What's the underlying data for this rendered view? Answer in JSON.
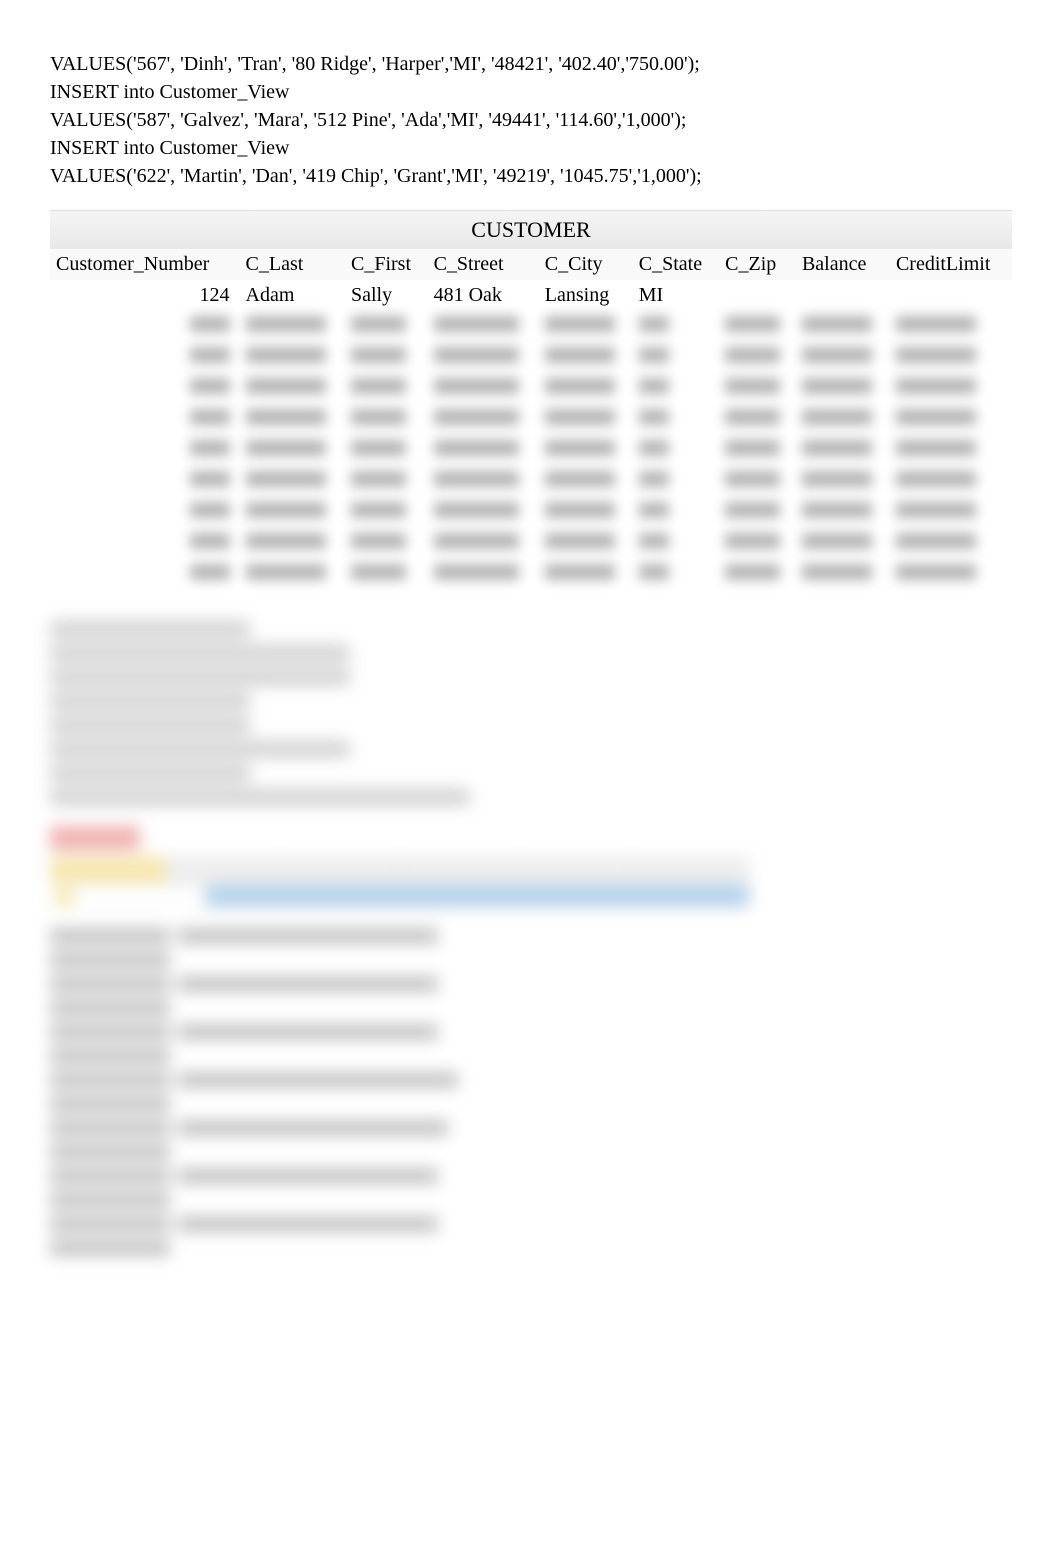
{
  "sql": {
    "lines": [
      "VALUES('567', 'Dinh', 'Tran', '80 Ridge', 'Harper','MI', '48421', '402.40','750.00');",
      "INSERT into Customer_View",
      "VALUES('587', 'Galvez', 'Mara', '512 Pine', 'Ada','MI', '49441', '114.60','1,000');",
      "INSERT into Customer_View",
      "VALUES('622', 'Martin', 'Dan', '419 Chip', 'Grant','MI', '49219', '1045.75','1,000');"
    ]
  },
  "table": {
    "title": "CUSTOMER",
    "headers": [
      "Customer_Number",
      "C_Last",
      "C_First",
      "C_Street",
      "C_City",
      "C_State",
      "C_Zip",
      "Balance",
      "CreditLimit"
    ],
    "rows": [
      {
        "clear": true,
        "cells": [
          "124",
          "Adam",
          "Sally",
          "481 Oak",
          "Lansing",
          "MI",
          "",
          "",
          ""
        ]
      },
      {
        "clear": false,
        "cells": [
          "",
          "",
          "",
          "",
          "",
          "",
          "",
          "",
          ""
        ]
      },
      {
        "clear": false,
        "cells": [
          "",
          "",
          "",
          "",
          "",
          "",
          "",
          "",
          ""
        ]
      },
      {
        "clear": false,
        "cells": [
          "",
          "",
          "",
          "",
          "",
          "",
          "",
          "",
          ""
        ]
      },
      {
        "clear": false,
        "cells": [
          "",
          "",
          "",
          "",
          "",
          "",
          "",
          "",
          ""
        ]
      },
      {
        "clear": false,
        "cells": [
          "",
          "",
          "",
          "",
          "",
          "",
          "",
          "",
          ""
        ]
      },
      {
        "clear": false,
        "cells": [
          "",
          "",
          "",
          "",
          "",
          "",
          "",
          "",
          ""
        ]
      },
      {
        "clear": false,
        "cells": [
          "",
          "",
          "",
          "",
          "",
          "",
          "",
          "",
          ""
        ]
      },
      {
        "clear": false,
        "cells": [
          "",
          "",
          "",
          "",
          "",
          "",
          "",
          "",
          ""
        ]
      },
      {
        "clear": false,
        "cells": [
          "",
          "",
          "",
          "",
          "",
          "",
          "",
          "",
          ""
        ]
      }
    ]
  }
}
